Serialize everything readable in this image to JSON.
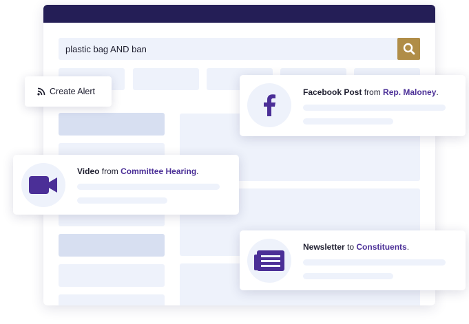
{
  "search": {
    "query": "plastic bag AND ban"
  },
  "alert_button": {
    "label": "Create Alert"
  },
  "cards": {
    "facebook": {
      "type": "Facebook Post",
      "connector": " from ",
      "source": "Rep. Maloney",
      "suffix": "."
    },
    "video": {
      "type": "Video",
      "connector": " from ",
      "source": "Committee Hearing",
      "suffix": "."
    },
    "newsletter": {
      "type": "Newsletter",
      "connector": " to ",
      "source": "Constituents",
      "suffix": "."
    }
  },
  "icons": {
    "search": "search-icon",
    "rss": "rss-icon",
    "facebook": "facebook-icon",
    "video": "video-camera-icon",
    "newsletter": "newsletter-icon"
  },
  "colors": {
    "titlebar": "#241e56",
    "accent": "#4b2f97",
    "search_button": "#b08d47",
    "placeholder": "#eef2fb"
  }
}
